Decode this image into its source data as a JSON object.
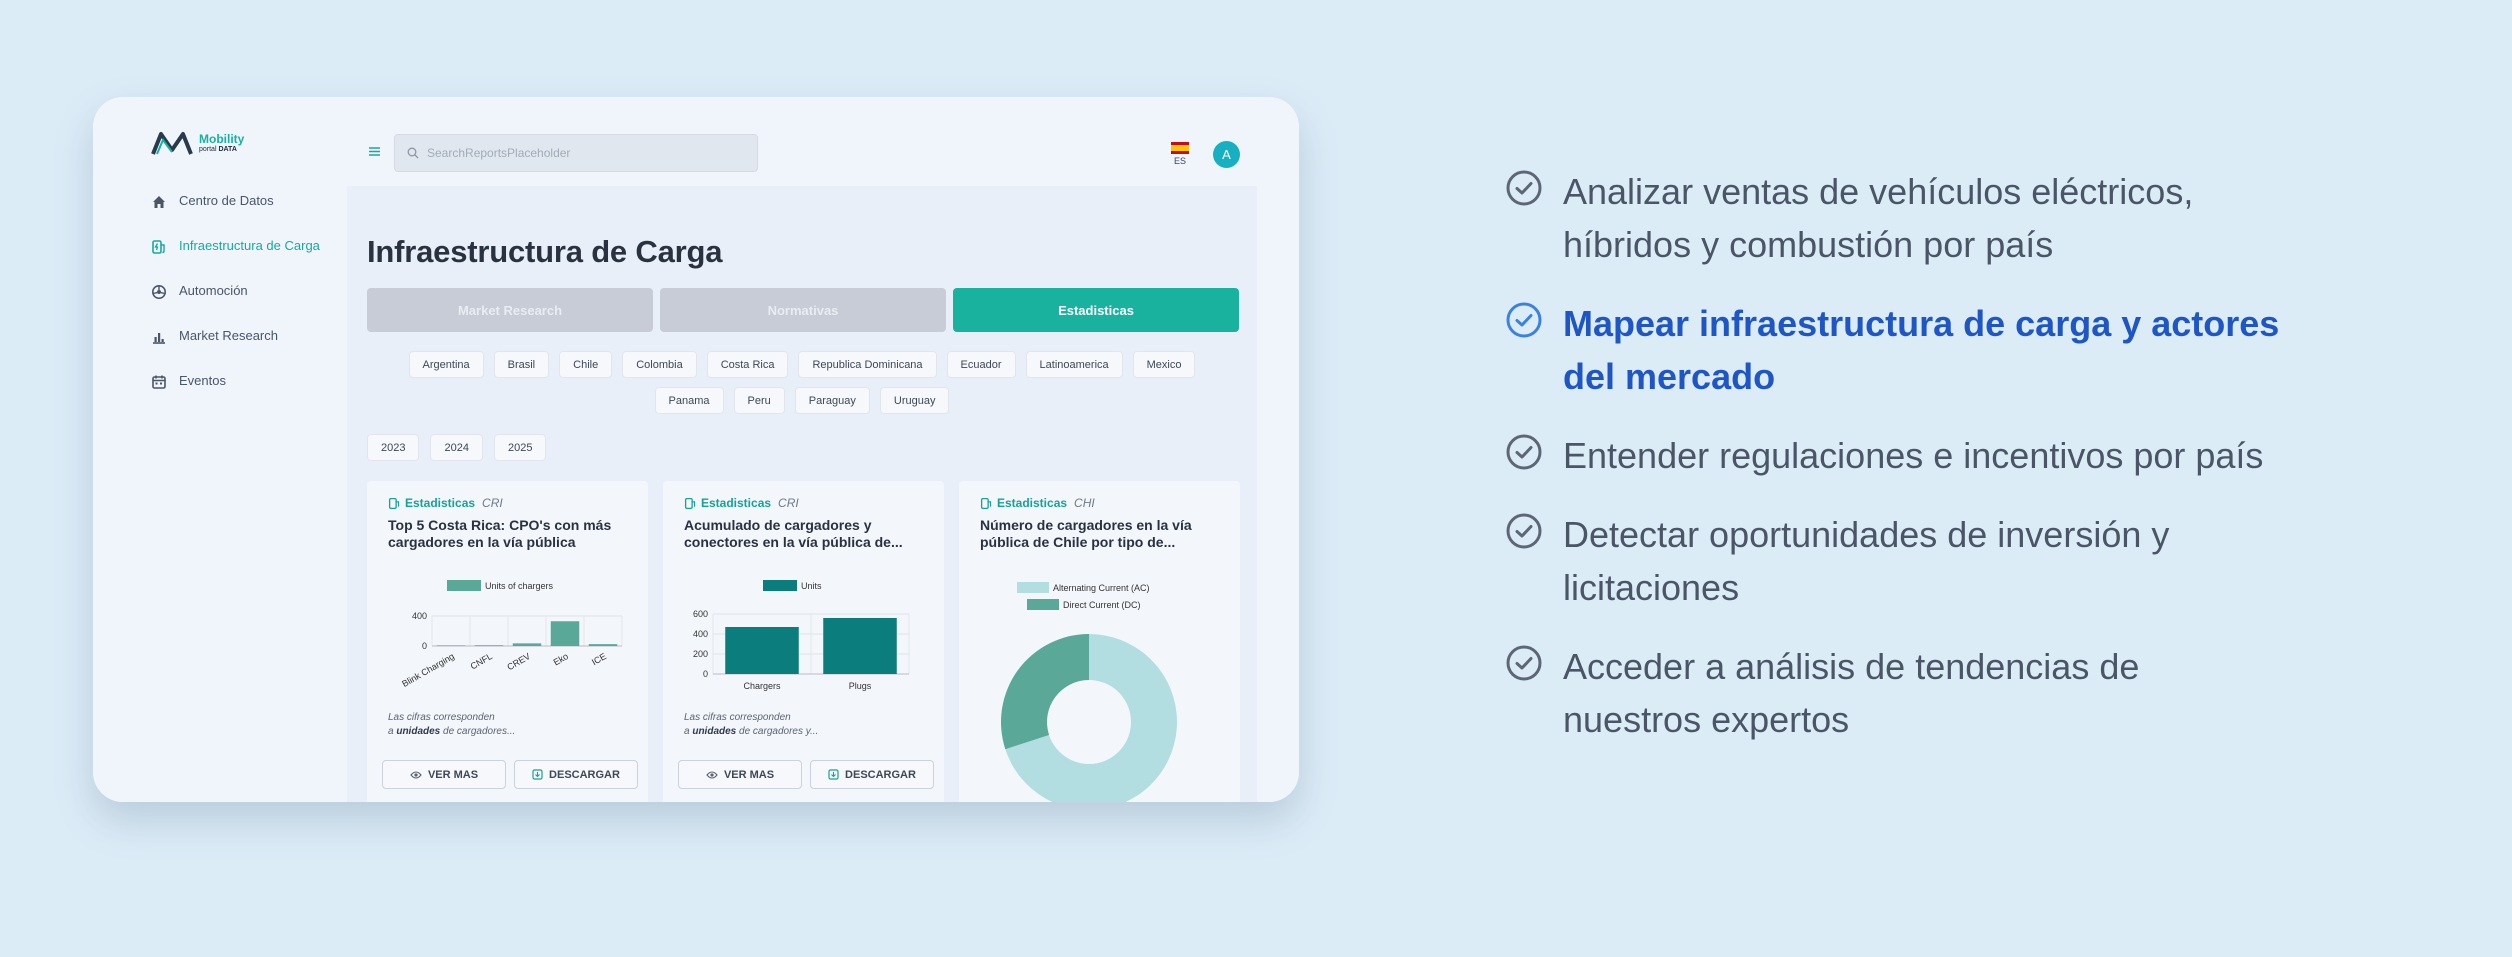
{
  "brand": {
    "name_pre": "Mobi",
    "name_accent": "li",
    "name_post": "ty",
    "sub_pre": "portal ",
    "sub_bold": "DATA"
  },
  "sidebar": {
    "items": [
      {
        "label": "Centro de Datos",
        "icon": "home-icon"
      },
      {
        "label": "Infraestructura de Carga",
        "icon": "charging-station-icon",
        "active": true
      },
      {
        "label": "Automoción",
        "icon": "car-wheel-icon"
      },
      {
        "label": "Market Research",
        "icon": "bar-chart-icon"
      },
      {
        "label": "Eventos",
        "icon": "calendar-icon"
      }
    ]
  },
  "header": {
    "search_placeholder": "SearchReportsPlaceholder",
    "lang": "ES",
    "avatar": "A"
  },
  "page": {
    "title": "Infraestructura de Carga",
    "tabs": [
      "Market Research",
      "Normativas",
      "Estadisticas"
    ],
    "countries_row1": [
      "Argentina",
      "Brasil",
      "Chile",
      "Colombia",
      "Costa Rica",
      "Republica Dominicana",
      "Ecuador",
      "Latinoamerica",
      "Mexico"
    ],
    "countries_row2": [
      "Panama",
      "Peru",
      "Paraguay",
      "Uruguay"
    ],
    "years": [
      "2023",
      "2024",
      "2025"
    ]
  },
  "cards": [
    {
      "category": "Estadisticas",
      "country": "CRI",
      "title": "Top 5 Costa Rica: CPO's con más cargadores en la vía pública",
      "desc_line1": "Las cifras corresponden",
      "desc_pre": "a ",
      "desc_bold": "unidades",
      "desc_post": " de cargadores...",
      "btn_more": "VER MAS",
      "btn_download": "DESCARGAR"
    },
    {
      "category": "Estadisticas",
      "country": "CRI",
      "title": "Acumulado de cargadores y conectores en la vía pública de...",
      "desc_line1": "Las cifras corresponden",
      "desc_pre": "a ",
      "desc_bold": "unidades",
      "desc_post": " de cargadores y...",
      "btn_more": "VER MAS",
      "btn_download": "DESCARGAR"
    },
    {
      "category": "Estadisticas",
      "country": "CHI",
      "title": "Número de cargadores en la vía pública de Chile por tipo de..."
    }
  ],
  "chart_data": [
    {
      "type": "bar",
      "categories": [
        "Blink Charging",
        "CNFL",
        "CREV",
        "Eko",
        "ICE"
      ],
      "series": [
        {
          "name": "Units of chargers",
          "values": [
            8,
            10,
            35,
            330,
            25
          ]
        }
      ],
      "ylim": [
        0,
        400
      ],
      "yticks": [
        0,
        400
      ],
      "color": "#5aa898"
    },
    {
      "type": "bar",
      "categories": [
        "Chargers",
        "Plugs"
      ],
      "series": [
        {
          "name": "Units",
          "values": [
            470,
            560
          ]
        }
      ],
      "ylim": [
        0,
        600
      ],
      "yticks": [
        0,
        200,
        400,
        600
      ],
      "color": "#0b7d7d"
    },
    {
      "type": "pie",
      "labels": [
        "Alternating Current (AC)",
        "Direct Current (DC)"
      ],
      "values": [
        70,
        30
      ],
      "colors": [
        "#b2dee2",
        "#5aa898"
      ]
    }
  ],
  "features": [
    {
      "text": "Analizar ventas de vehículos eléctricos, híbridos y combustión por país"
    },
    {
      "text": "Mapear infraestructura de carga y actores del mercado",
      "highlight": true
    },
    {
      "text": "Entender regulaciones e incentivos por país"
    },
    {
      "text": "Detectar oportunidades de inversión y licitaciones"
    },
    {
      "text": "Acceder a análisis de tendencias de nuestros expertos"
    }
  ]
}
